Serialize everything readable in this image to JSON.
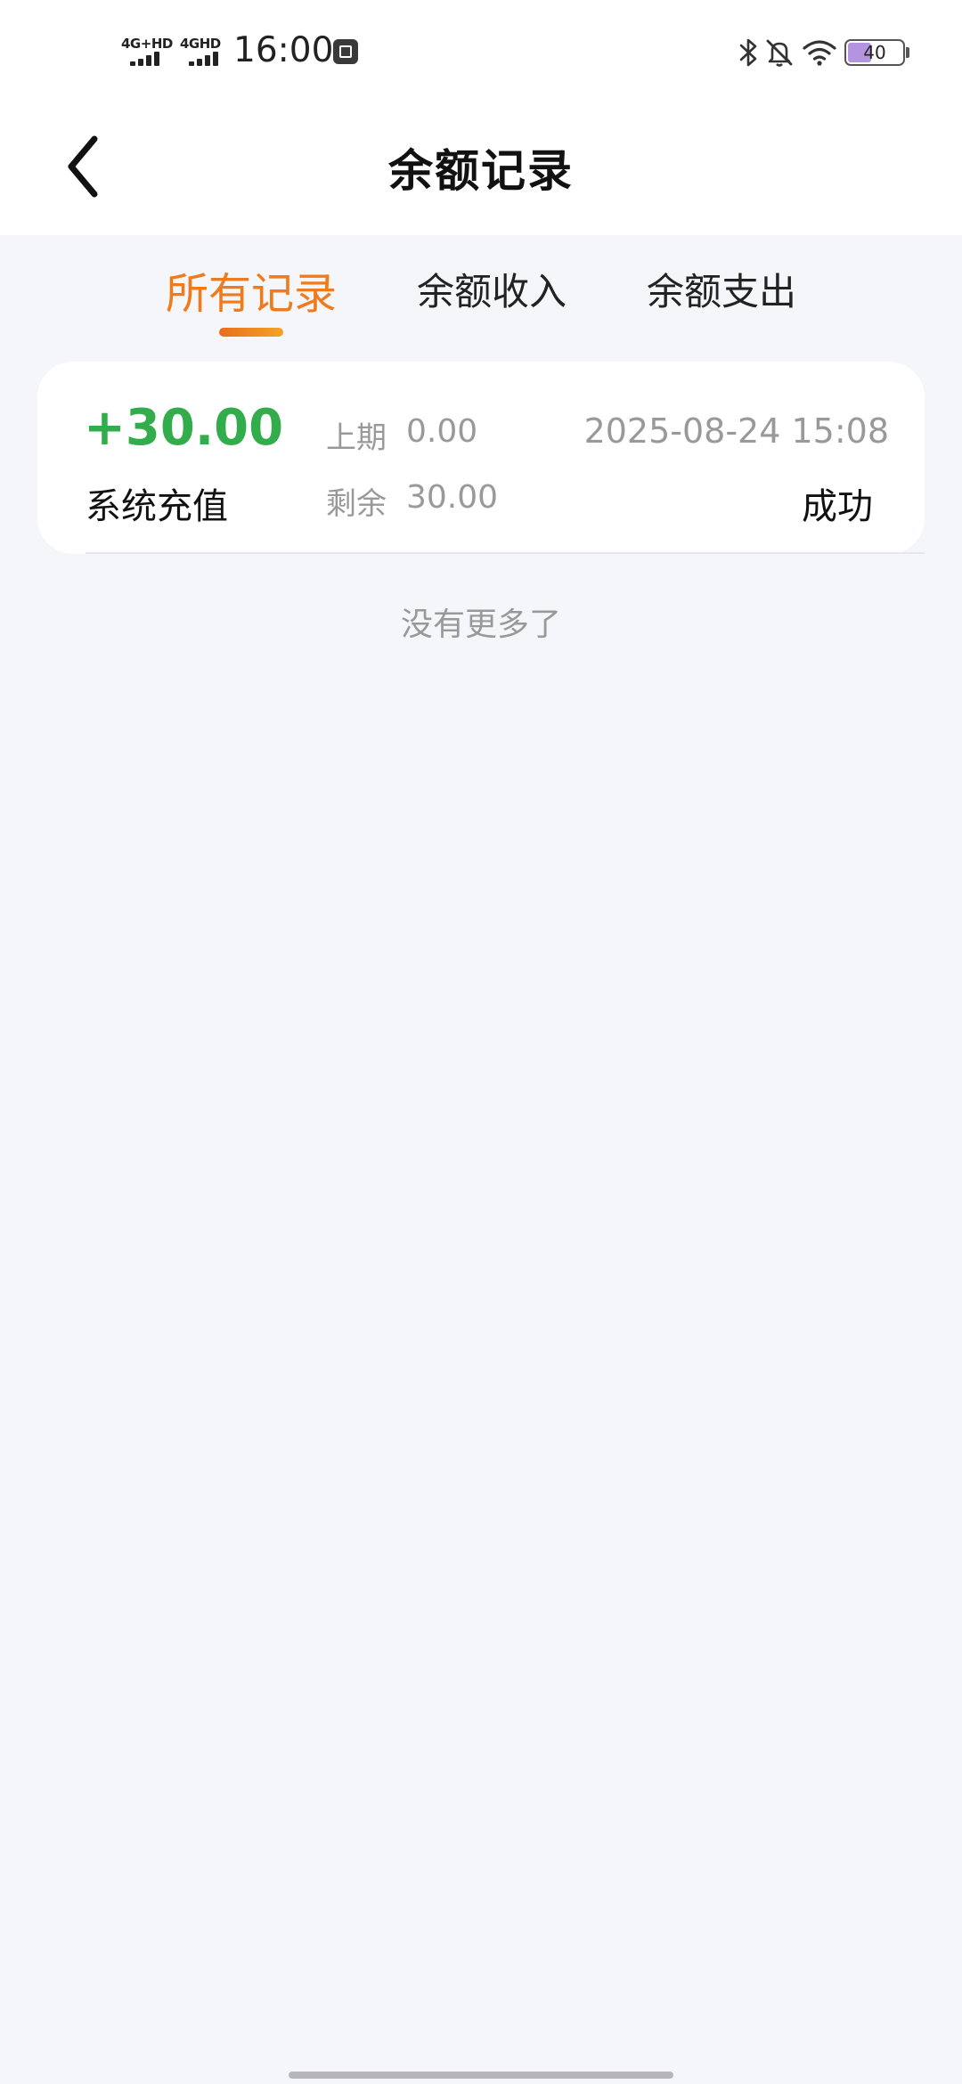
{
  "status_bar": {
    "signal_1_label": "4G+HD",
    "signal_2_label": "4GHD",
    "time": "16:00",
    "battery_level": "40",
    "icons": [
      "signal-icon",
      "signal-icon",
      "notification-icon",
      "bluetooth-icon",
      "mute-icon",
      "wifi-icon",
      "battery-icon"
    ]
  },
  "header": {
    "title": "余额记录",
    "back_icon": "chevron-left-icon"
  },
  "tabs": {
    "items": [
      {
        "label": "所有记录",
        "active": true
      },
      {
        "label": "余额收入",
        "active": false
      },
      {
        "label": "余额支出",
        "active": false
      }
    ],
    "active_color": "#ee7b1c"
  },
  "records": [
    {
      "amount": "+30.00",
      "type": "系统充值",
      "previous_label": "上期",
      "previous_value": "0.00",
      "remaining_label": "剩余",
      "remaining_value": "30.00",
      "datetime": "2025-08-24  15:08",
      "status": "成功"
    }
  ],
  "footer": {
    "no_more_text": "没有更多了"
  },
  "colors": {
    "income_green": "#33ad4b",
    "accent_orange": "#ee7b1c",
    "page_background": "#f5f6fa"
  }
}
